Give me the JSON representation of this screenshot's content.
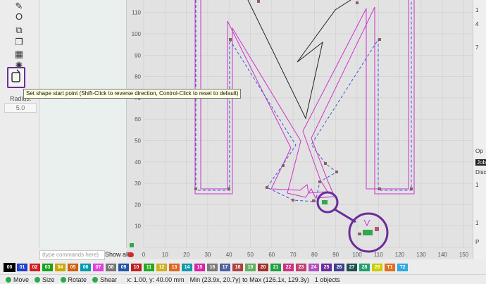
{
  "toolbar": {
    "tools": [
      {
        "name": "pen-tool",
        "glyph": "✎"
      },
      {
        "name": "ring-tool",
        "glyph": "O"
      },
      {
        "name": "copy-tool",
        "glyph": "⧉"
      },
      {
        "name": "duplicate-tool",
        "glyph": "❐"
      },
      {
        "name": "grid-array-tool",
        "glyph": "▦"
      },
      {
        "name": "circular-array-tool",
        "glyph": "✺"
      }
    ],
    "shape_start_icon": "shape-start-icon",
    "radius_label": "Radius:",
    "radius_value": "5.0"
  },
  "tooltip": "Set shape start point (Shift-Click to reverse direction, Control-Click to reset to default)",
  "canvas": {
    "x_ticks": [
      "0",
      "10",
      "20",
      "30",
      "40",
      "50",
      "60",
      "70",
      "80",
      "90",
      "100",
      "110",
      "120",
      "130",
      "140",
      "150"
    ],
    "y_ticks": [
      "110",
      "100",
      "90",
      "80",
      "70",
      "60",
      "50",
      "40",
      "30",
      "20",
      "10"
    ],
    "colors": {
      "grid": "#d0d0d0",
      "magenta": "#cc33cc",
      "blue": "#3a5ad8",
      "black": "#222222",
      "annotation": "#6a2d9c"
    }
  },
  "right_panel": {
    "items": [
      "Op",
      "Job",
      "Disc",
      "P"
    ],
    "numbers": [
      "1",
      "4",
      "7",
      "1",
      "1"
    ]
  },
  "command_input_placeholder": "(type commands here)",
  "show_all_label": "Show all",
  "palette": [
    {
      "label": "00",
      "color": "#000000"
    },
    {
      "label": "01",
      "color": "#1f3fcf"
    },
    {
      "label": "02",
      "color": "#cc2020"
    },
    {
      "label": "03",
      "color": "#1aa01a"
    },
    {
      "label": "04",
      "color": "#c8a800"
    },
    {
      "label": "05",
      "color": "#d06010"
    },
    {
      "label": "06",
      "color": "#009ab0"
    },
    {
      "label": "07",
      "color": "#e040e0"
    },
    {
      "label": "08",
      "color": "#777777"
    },
    {
      "label": "09",
      "color": "#2055aa"
    },
    {
      "label": "10",
      "color": "#c02020"
    },
    {
      "label": "11",
      "color": "#22aa22"
    },
    {
      "label": "12",
      "color": "#d0b020"
    },
    {
      "label": "13",
      "color": "#dd6622"
    },
    {
      "label": "14",
      "color": "#1199aa"
    },
    {
      "label": "15",
      "color": "#dd22aa"
    },
    {
      "label": "16",
      "color": "#7a7a7a"
    },
    {
      "label": "17",
      "color": "#5060a0"
    },
    {
      "label": "18",
      "color": "#b04040"
    },
    {
      "label": "19",
      "color": "#60b060"
    },
    {
      "label": "20",
      "color": "#a03030"
    },
    {
      "label": "21",
      "color": "#20a040"
    },
    {
      "label": "22",
      "color": "#cc3080"
    },
    {
      "label": "23",
      "color": "#c04070"
    },
    {
      "label": "24",
      "color": "#b050c0"
    },
    {
      "label": "25",
      "color": "#6a2d9c"
    },
    {
      "label": "26",
      "color": "#404090"
    },
    {
      "label": "27",
      "color": "#205050"
    },
    {
      "label": "28",
      "color": "#20a070"
    },
    {
      "label": "29",
      "color": "#cccc00"
    },
    {
      "label": "T1",
      "color": "#e07020"
    },
    {
      "label": "T2",
      "color": "#30a8e0"
    }
  ],
  "status": {
    "move": "Move",
    "size": "Size",
    "rotate": "Rotate",
    "shear": "Shear",
    "coords": "x: 1.00, y: 40.00 mm",
    "bounds": "Min (23.9x, 20.7y) to Max (126.1x, 129.3y)",
    "objects": "1 objects"
  }
}
